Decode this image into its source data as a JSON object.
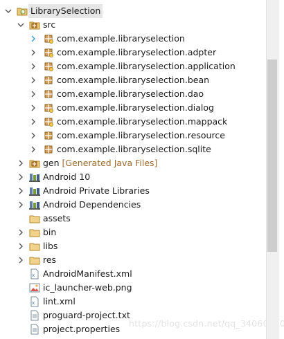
{
  "project": {
    "name": "LibrarySelection",
    "icon": "android-project-icon"
  },
  "src": {
    "label": "src",
    "icon": "source-folder-icon"
  },
  "packages": [
    {
      "label": "com.example.libraryselection",
      "icon": "package-icon"
    },
    {
      "label": "com.example.libraryselection.adpter",
      "icon": "package-icon"
    },
    {
      "label": "com.example.libraryselection.application",
      "icon": "package-icon"
    },
    {
      "label": "com.example.libraryselection.bean",
      "icon": "package-icon"
    },
    {
      "label": "com.example.libraryselection.dao",
      "icon": "package-icon"
    },
    {
      "label": "com.example.libraryselection.dialog",
      "icon": "package-icon"
    },
    {
      "label": "com.example.libraryselection.mappack",
      "icon": "package-icon"
    },
    {
      "label": "com.example.libraryselection.resource",
      "icon": "package-icon"
    },
    {
      "label": "com.example.libraryselection.sqlite",
      "icon": "package-icon"
    }
  ],
  "gen": {
    "label": "gen",
    "extra": "[Generated Java Files]"
  },
  "libraries": [
    {
      "label": "Android 10",
      "icon": "library-icon"
    },
    {
      "label": "Android Private Libraries",
      "icon": "library-icon"
    },
    {
      "label": "Android Dependencies",
      "icon": "library-icon"
    }
  ],
  "folders": [
    {
      "label": "assets",
      "expandable": false
    },
    {
      "label": "bin",
      "expandable": true
    },
    {
      "label": "libs",
      "expandable": true
    },
    {
      "label": "res",
      "expandable": true
    }
  ],
  "files": [
    {
      "label": "AndroidManifest.xml",
      "icon": "xml-file-icon"
    },
    {
      "label": "ic_launcher-web.png",
      "icon": "image-file-icon"
    },
    {
      "label": "lint.xml",
      "icon": "xml-file-icon"
    },
    {
      "label": "proguard-project.txt",
      "icon": "text-file-icon"
    },
    {
      "label": "project.properties",
      "icon": "text-file-icon"
    }
  ],
  "watermark": "https://blog.csdn.net/qq_34060370",
  "colors": {
    "selection": "#e6e6e6",
    "decorator": "#9b6a2e",
    "scrollbar_thumb": "#cdcdcd"
  }
}
